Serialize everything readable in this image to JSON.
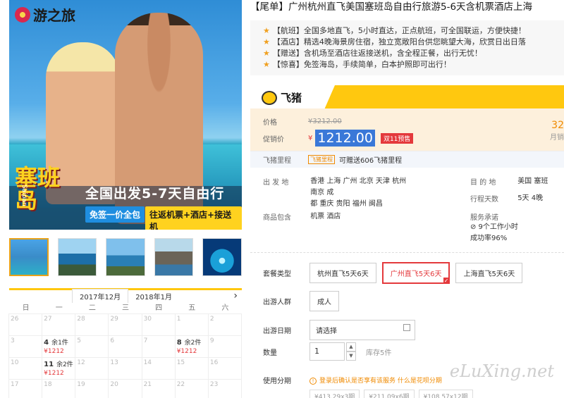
{
  "hero": {
    "logo_text": "游之旅",
    "saipan_cn": "塞班岛",
    "saipan_en": "Saipan",
    "headline": "全国出发5-7天自由行",
    "pill1": "免签一价全包",
    "pill2": "往返机票+酒店+接送机"
  },
  "calendar": {
    "months": [
      "2017年12月",
      "2018年1月"
    ],
    "next": "›",
    "weekdays": [
      "日",
      "一",
      "二",
      "三",
      "四",
      "五",
      "六"
    ],
    "rows": [
      [
        {
          "d": "26"
        },
        {
          "d": "27"
        },
        {
          "d": "28"
        },
        {
          "d": "29"
        },
        {
          "d": "30"
        },
        {
          "d": "1"
        },
        {
          "d": "2"
        }
      ],
      [
        {
          "d": "3"
        },
        {
          "d": "4",
          "stock": "余1件",
          "price": "¥1212"
        },
        {
          "d": "5"
        },
        {
          "d": "6"
        },
        {
          "d": "7"
        },
        {
          "d": "8",
          "stock": "余2件",
          "price": "¥1212"
        },
        {
          "d": "9"
        }
      ],
      [
        {
          "d": "10"
        },
        {
          "d": "11",
          "stock": "余2件",
          "price": "¥1212"
        },
        {
          "d": "12"
        },
        {
          "d": "13"
        },
        {
          "d": "14"
        },
        {
          "d": "15"
        },
        {
          "d": "16"
        }
      ],
      [
        {
          "d": "17"
        },
        {
          "d": "18"
        },
        {
          "d": "19"
        },
        {
          "d": "20"
        },
        {
          "d": "21"
        },
        {
          "d": "22"
        },
        {
          "d": "23"
        }
      ]
    ]
  },
  "product": {
    "title": "【尾单】广州杭州直飞美国塞班岛自由行旅游5-6天含机票酒店上海",
    "features": [
      "【航班】全国多地直飞，5小时直达，正点航班，可全国联运，方便快捷！",
      "【酒店】精选4晚海景房住宿，独立宽敞阳台供您眺望大海，欣赏日出日落",
      "【赠送】含机场至酒店往返接送机，含全程正餐，出行无忧！",
      "【惊喜】免签海岛，手续简单，白本护照即可出行！"
    ]
  },
  "fliggy": {
    "logo_text": "飞猪"
  },
  "price": {
    "orig_label": "价格",
    "orig_value": "¥3212.00",
    "cur_label": "促销价",
    "currency": "¥",
    "cur_value": "1212.00",
    "sale_tag": "双11预售",
    "stat_value": "32",
    "stat_label": "月销"
  },
  "miles": {
    "label": "飞猪里程",
    "tag": "飞猪里程",
    "text": "可赠送606飞猪里程"
  },
  "info": {
    "depart_label": "出 发 地",
    "depart_line1": "香港  上海  广州  北京  天津  杭州  南京  成",
    "depart_line2": "都  重庆  贵阳  福州  闽昌",
    "dest_label": "目 的 地",
    "dest_value": "美国  塞班",
    "days_label": "行程天数",
    "days_value": "5天  4晚",
    "includes_label": "商品包含",
    "includes_value": "机票  酒店",
    "service_label": "服务承诺",
    "service_line1": "⊘ 9个工作小时",
    "service_line2": "成功率96%"
  },
  "form": {
    "package_label": "套餐类型",
    "packages": [
      "杭州直飞5天6天",
      "广州直飞5天6天",
      "上海直飞5天6天"
    ],
    "people_label": "出游人群",
    "people_value": "成人",
    "date_label": "出游日期",
    "date_placeholder": "请选择",
    "qty_label": "数量",
    "qty_value": "1",
    "qty_up": "▲",
    "qty_down": "▼",
    "stock": "库存5件",
    "inst_label": "使用分期",
    "inst_note": "登录后确认是否享有该服务",
    "inst_link": "什么是花呗分期",
    "inst_opts": [
      "¥413.29x3期",
      "¥211.09x6期",
      "¥108.57x12期"
    ]
  },
  "watermark": "eLuXing.net"
}
